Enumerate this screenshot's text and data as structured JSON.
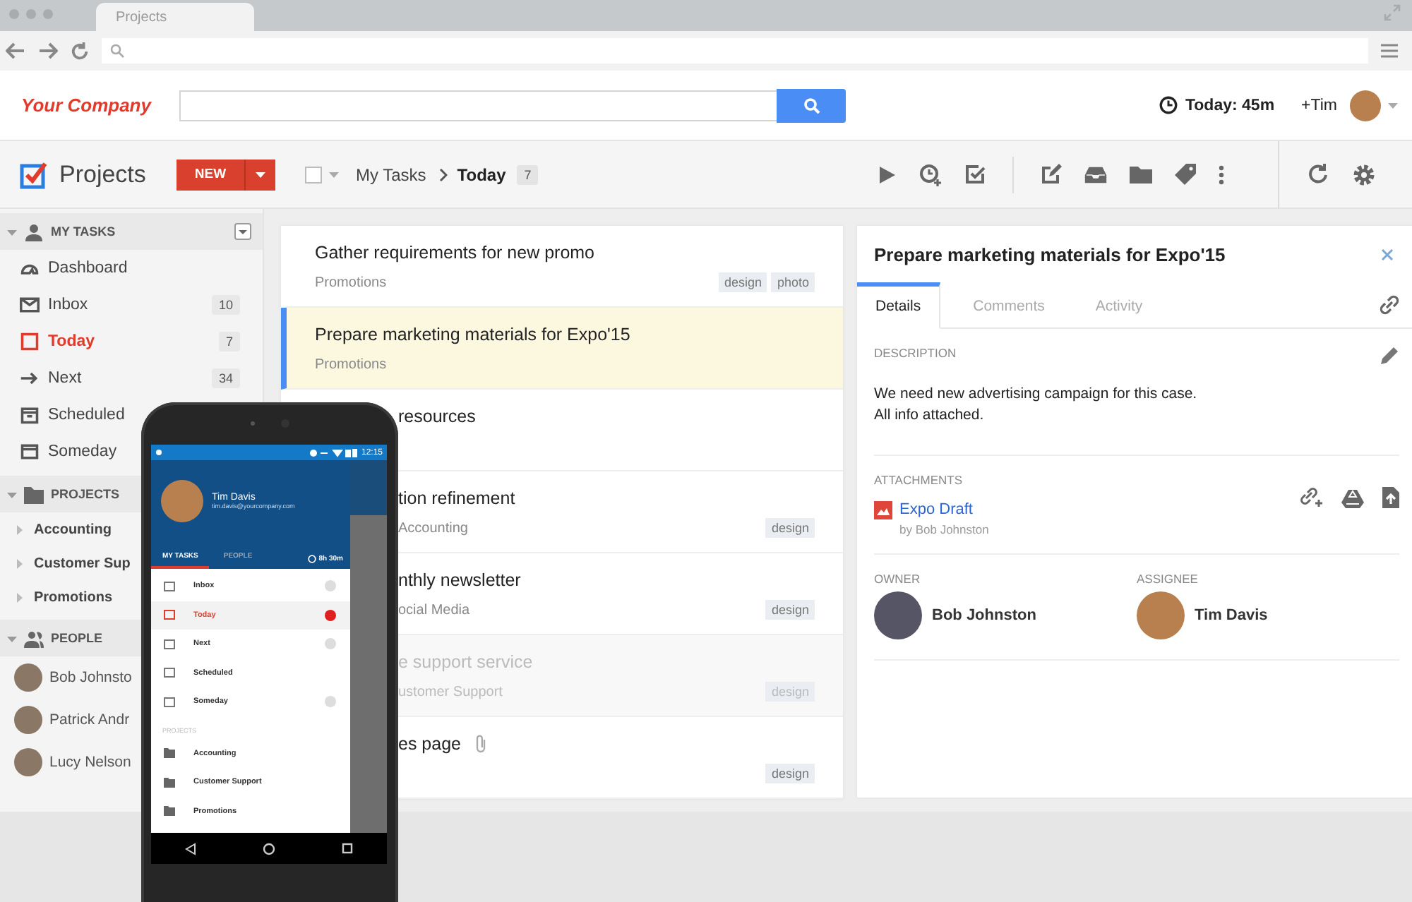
{
  "browser": {
    "tab": "Projects"
  },
  "header": {
    "logo": "Your Company",
    "timer": "Today: 45m",
    "user": "+Tim"
  },
  "toolbar": {
    "title": "Projects",
    "select_checked": false,
    "new_button": "NEW",
    "breadcrumb": [
      "My Tasks",
      "Today"
    ],
    "count": "7"
  },
  "sidebar": {
    "sections": [
      {
        "title": "MY TASKS",
        "kind": "nav",
        "expanded": true,
        "items": [
          {
            "label": "Dashboard",
            "selected": false
          },
          {
            "label": "Inbox",
            "count": "10",
            "selected": false
          },
          {
            "label": "Today",
            "count": "7",
            "selected": true
          },
          {
            "label": "Next",
            "count": "34",
            "selected": false
          },
          {
            "label": "Scheduled",
            "selected": false
          },
          {
            "label": "Someday",
            "selected": false
          }
        ]
      },
      {
        "title": "PROJECTS",
        "kind": "projects",
        "expanded": true,
        "items": [
          {
            "label": "Accounting",
            "selected": false
          },
          {
            "label": "Customer Sup",
            "selected": false
          },
          {
            "label": "Promotions",
            "selected": false
          }
        ]
      },
      {
        "title": "PEOPLE",
        "kind": "people",
        "expanded": true,
        "items": [
          {
            "label": "Bob Johnsto",
            "selected": false
          },
          {
            "label": "Patrick Andr",
            "selected": false
          },
          {
            "label": "Lucy Nelson",
            "selected": false
          }
        ]
      }
    ]
  },
  "tasks": [
    {
      "title": "Gather requirements for new promo",
      "project": "Promotions",
      "tags": [
        "design",
        "photo"
      ],
      "selected": false,
      "disabled": false,
      "attachment": false
    },
    {
      "title": "Prepare marketing materials for Expo'15",
      "project": "Promotions",
      "selected": true,
      "disabled": false,
      "attachment": false
    },
    {
      "title": "resources",
      "selected": false,
      "disabled": false,
      "attachment": false
    },
    {
      "title": "tion refinement",
      "project": "Accounting",
      "tags": [
        "design"
      ],
      "selected": false,
      "disabled": false,
      "attachment": false
    },
    {
      "title": "nthly newsletter",
      "project": "ocial Media",
      "tags": [
        "design"
      ],
      "selected": false,
      "disabled": false,
      "attachment": false
    },
    {
      "title": "e support service",
      "project": "ustomer Support",
      "tags": [
        "design"
      ],
      "selected": false,
      "disabled": true,
      "attachment": false
    },
    {
      "title": "es page",
      "tags": [
        "design"
      ],
      "selected": false,
      "disabled": false,
      "attachment": true
    }
  ],
  "detail": {
    "title": "Prepare marketing materials for Expo'15",
    "tabs": [
      {
        "label": "Details",
        "selected": true
      },
      {
        "label": "Comments",
        "selected": false
      },
      {
        "label": "Activity",
        "selected": false
      }
    ],
    "description_label": "DESCRIPTION",
    "description": "We need new advertising campaign for this case.\nAll info attached.",
    "attachments_label": "ATTACHMENTS",
    "attachment": {
      "name": "Expo Draft",
      "author": "by Bob Johnston"
    },
    "owner_label": "OWNER",
    "owner": "Bob Johnston",
    "assignee_label": "ASSIGNEE",
    "assignee": "Tim Davis"
  },
  "phone": {
    "time": "12:15",
    "user": "Tim Davis",
    "email": "tim.davis@yourcompany.com",
    "tabs": [
      {
        "label": "MY TASKS",
        "selected": true
      },
      {
        "label": "PEOPLE",
        "selected": false
      }
    ],
    "timer": "8h 30m",
    "items": [
      {
        "label": "Inbox",
        "selected": false,
        "badge": true
      },
      {
        "label": "Today",
        "selected": true,
        "badge": true
      },
      {
        "label": "Next",
        "selected": false,
        "badge": true
      },
      {
        "label": "Scheduled",
        "selected": false,
        "badge": false
      },
      {
        "label": "Someday",
        "selected": false,
        "badge": true
      }
    ],
    "projects_label": "PROJECTS",
    "projects": [
      "Accounting",
      "Customer Support",
      "Promotions"
    ]
  }
}
